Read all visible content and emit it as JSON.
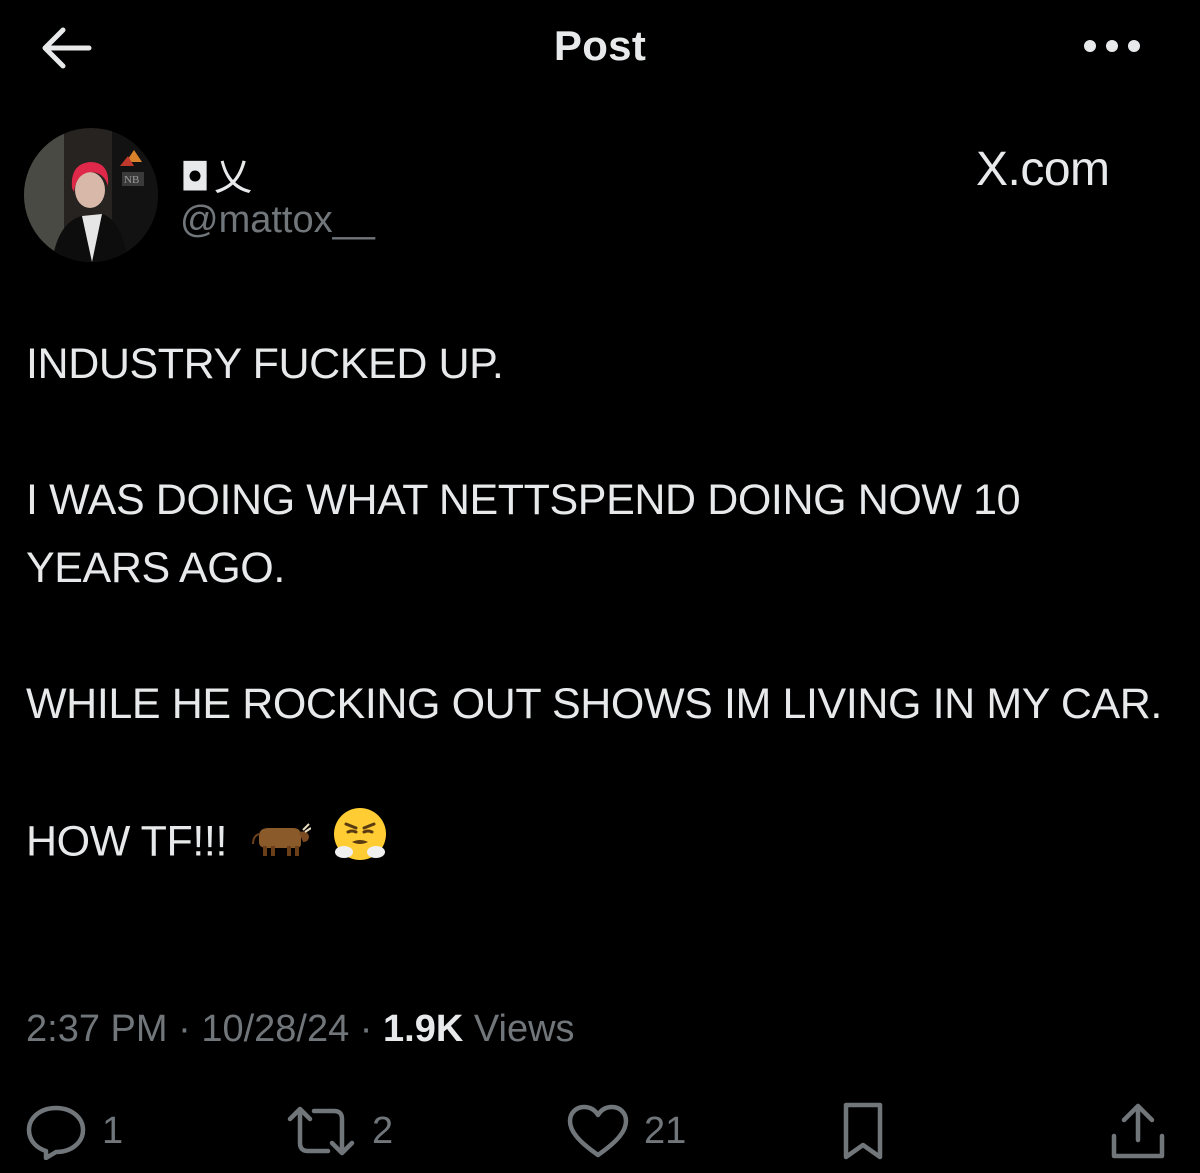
{
  "header": {
    "title": "Post",
    "back_icon": "arrow-left-icon",
    "more_icon": "more-horizontal-icon"
  },
  "author": {
    "display_name": "◘乂",
    "handle": "@mattox__",
    "avatar": "avatar-photo"
  },
  "watermark": "X.com",
  "tweet": {
    "paragraphs": [
      "INDUSTRY FUCKED UP.",
      "I WAS DOING WHAT NETTSPEND DOING NOW 10 YEARS AGO.",
      "WHILE HE ROCKING OUT SHOWS IM LIVING IN MY CAR."
    ],
    "last_line_text": "HOW TF!!!",
    "emojis": [
      "ox-emoji",
      "face-with-steam-emoji"
    ]
  },
  "meta": {
    "time": "2:37 PM",
    "date": "10/28/24",
    "views_count": "1.9K",
    "views_label": "Views",
    "separator": "·"
  },
  "actions": {
    "reply_count": "1",
    "repost_count": "2",
    "like_count": "21"
  },
  "colors": {
    "background": "#000000",
    "primary_text": "#e7e9ea",
    "secondary_text": "#71767b"
  }
}
